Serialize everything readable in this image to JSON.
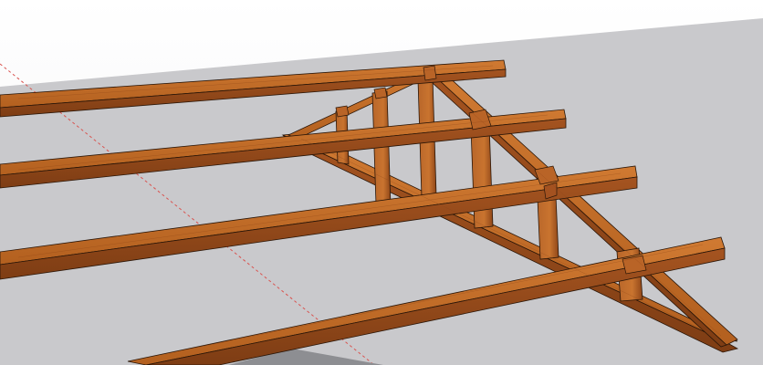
{
  "viewport": {
    "background_sky": "#ffffff",
    "background_ground": "#c9c9cc",
    "wood_light": "#c8702a",
    "wood_mid": "#a9561f",
    "wood_dark": "#7a3a12",
    "edge_color": "#2a1608",
    "axis_color": "#d9534f",
    "shadow_color": "#8a8a8e"
  }
}
